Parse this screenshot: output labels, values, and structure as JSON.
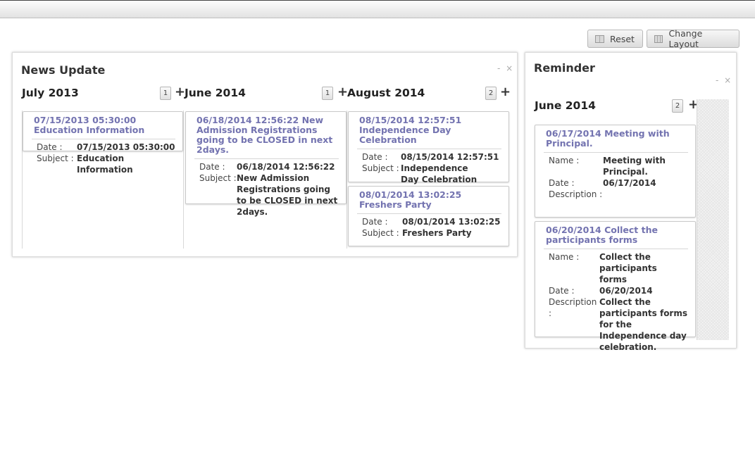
{
  "toolbar": {
    "reset_label": "Reset",
    "change_layout_label": "Change Layout"
  },
  "news_widget": {
    "title": "News Update",
    "controls": "- ×",
    "columns": [
      {
        "heading": "July 2013",
        "count": "1",
        "add_symbol": "+",
        "cards": [
          {
            "title": "07/15/2013 05:30:00 Education Information",
            "fields": [
              {
                "label": "Date :",
                "value": "07/15/2013 05:30:00"
              },
              {
                "label": "Subject :",
                "value": "Education Information"
              }
            ]
          }
        ]
      },
      {
        "heading": "June 2014",
        "count": "1",
        "add_symbol": "+",
        "cards": [
          {
            "title": "06/18/2014 12:56:22 New Admission Registrations going to be CLOSED in next 2days.",
            "fields": [
              {
                "label": "Date :",
                "value": "06/18/2014 12:56:22"
              },
              {
                "label": "Subject :",
                "value": "New Admission Registrations going to be CLOSED in next 2days."
              }
            ]
          }
        ]
      },
      {
        "heading": "August 2014",
        "count": "2",
        "add_symbol": "+",
        "cards": [
          {
            "title": "08/15/2014 12:57:51 Independence Day Celebration",
            "fields": [
              {
                "label": "Date :",
                "value": "08/15/2014 12:57:51"
              },
              {
                "label": "Subject :",
                "value": "Independence Day Celebration"
              }
            ]
          },
          {
            "title": "08/01/2014 13:02:25 Freshers Party",
            "fields": [
              {
                "label": "Date :",
                "value": "08/01/2014 13:02:25"
              },
              {
                "label": "Subject :",
                "value": "Freshers Party"
              }
            ]
          }
        ]
      }
    ]
  },
  "reminder_widget": {
    "title": "Reminder",
    "controls": "- ×",
    "columns": [
      {
        "heading": "June 2014",
        "count": "2",
        "add_symbol": "+",
        "cards": [
          {
            "title": "06/17/2014 Meeting with Principal.",
            "fields": [
              {
                "label": "Name :",
                "value": "Meeting with Principal."
              },
              {
                "label": "Date :",
                "value": "06/17/2014"
              },
              {
                "label": "Description :",
                "value": ""
              }
            ]
          },
          {
            "title": "06/20/2014 Collect the participants forms",
            "fields": [
              {
                "label": "Name :",
                "value": "Collect the participants forms"
              },
              {
                "label": "Date :",
                "value": "06/20/2014"
              },
              {
                "label": "Description :",
                "value": "Collect the participants forms for the Independence day celebration."
              }
            ]
          }
        ]
      }
    ]
  }
}
